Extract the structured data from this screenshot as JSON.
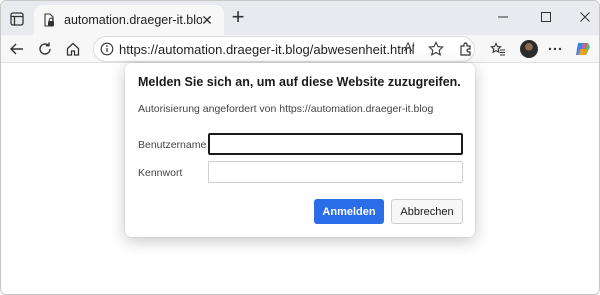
{
  "tab": {
    "title": "automation.draeger-it.blog/abwesenheit.html",
    "favicon": "page-with-lock-icon",
    "close_label": "✕",
    "newtab_label": "+"
  },
  "window_controls": {
    "minimize": "minimize-icon",
    "maximize": "maximize-icon",
    "close": "close-icon"
  },
  "toolbar": {
    "url": "https://automation.draeger-it.blog/abwesenheit.html",
    "read_aloud_label": "A⁾"
  },
  "dialog": {
    "title": "Melden Sie sich an, um auf diese Website zuzugreifen.",
    "subtitle": "Autorisierung angefordert von https://automation.draeger-it.blog",
    "username_label": "Benutzername",
    "username_value": "",
    "password_label": "Kennwort",
    "password_value": "",
    "login_button": "Anmelden",
    "cancel_button": "Abbrechen"
  },
  "colors": {
    "accent": "#2b6de9",
    "tabstrip": "#e9eaef",
    "toolbar": "#f7f7f7"
  }
}
